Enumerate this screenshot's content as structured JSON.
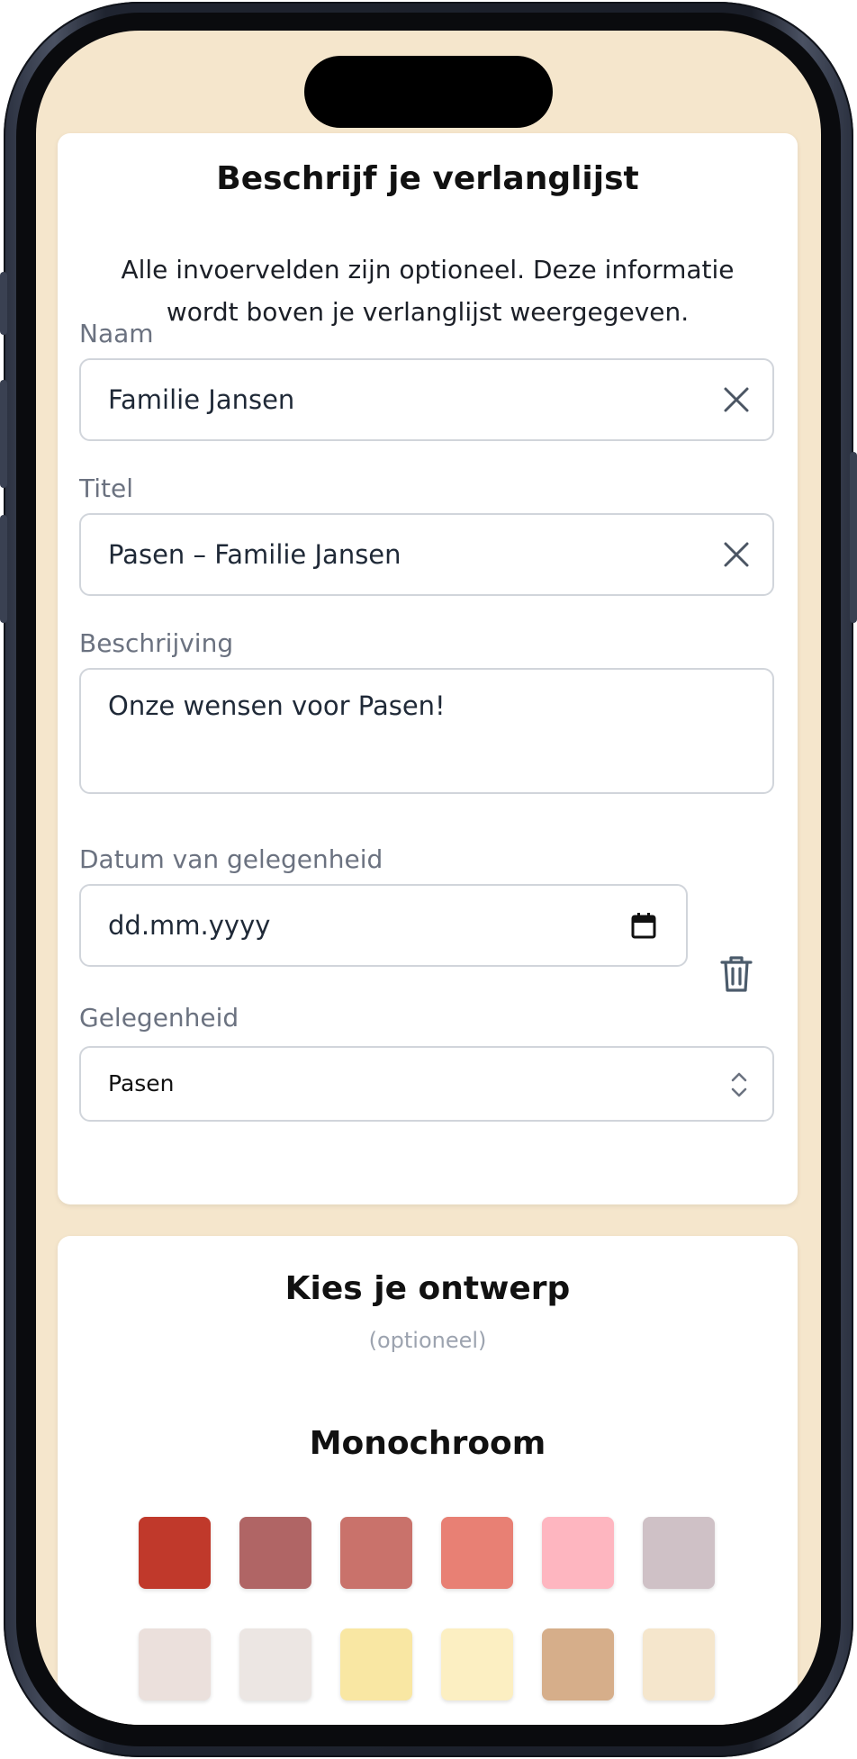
{
  "form": {
    "title": "Beschrijf je verlanglijst",
    "intro": "Alle invoervelden zijn optioneel. Deze informatie wordt boven je verlanglijst weergegeven.",
    "name": {
      "label": "Naam",
      "value": "Familie Jansen"
    },
    "wishlist_title": {
      "label": "Titel",
      "value": "Pasen – Familie Jansen"
    },
    "description": {
      "label": "Beschrijving",
      "value": "Onze wensen voor Pasen!"
    },
    "date": {
      "label": "Datum van gelegenheid",
      "placeholder": "dd.mm.yyyy"
    },
    "occasion": {
      "label": "Gelegenheid",
      "value": "Pasen"
    }
  },
  "design": {
    "title": "Kies je ontwerp",
    "subtitle": "(optioneel)",
    "group_title": "Monochroom",
    "swatches": [
      "#c0392b",
      "#b06565",
      "#c9726b",
      "#e88074",
      "#feb6c0",
      "#cfc1c6",
      "#ebe0dc",
      "#ece6e3",
      "#f9e7a3",
      "#fcefc2",
      "#d6ae8a",
      "#f5e6cc"
    ]
  },
  "colors": {
    "screen_background": "#f5e6cc",
    "field_border": "#d1d5db",
    "label": "#6b7280",
    "icon": "#4b5563"
  },
  "icons": {
    "clear": "close-icon",
    "calendar": "calendar-icon",
    "delete": "trash-icon",
    "select": "chevron-up-down-icon"
  }
}
